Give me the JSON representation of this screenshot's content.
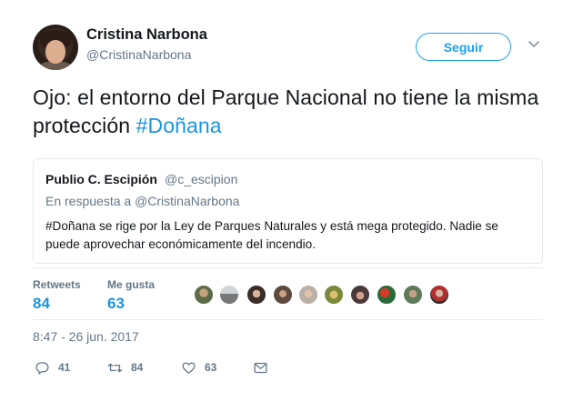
{
  "author": {
    "name": "Cristina Narbona",
    "handle": "@CristinaNarbona"
  },
  "follow_label": "Seguir",
  "tweet": {
    "text": "Ojo: el entorno del Parque Nacional no tiene la misma protección ",
    "hashtag": "#Doñana"
  },
  "quoted": {
    "name": "Publio C. Escipión",
    "handle": "@c_escipion",
    "reply_prefix": "En respuesta a ",
    "reply_to": "@CristinaNarbona",
    "text": "#Doñana se rige por la Ley de Parques Naturales y está mega protegido. Nadie se puede aprovechar económicamente del incendio."
  },
  "stats": {
    "retweets_label": "Retweets",
    "retweets": "84",
    "likes_label": "Me gusta",
    "likes": "63"
  },
  "timestamp": "8:47 - 26 jun. 2017",
  "actions": {
    "replies": "41",
    "retweets": "84",
    "likes": "63"
  },
  "colors": {
    "accent": "#1da1f2",
    "hashtag": "#1b95e0",
    "secondary_text": "#657786",
    "border": "#e1e8ed"
  },
  "icons": [
    "reply-icon",
    "retweet-icon",
    "heart-icon",
    "envelope-icon",
    "chevron-down-icon"
  ]
}
